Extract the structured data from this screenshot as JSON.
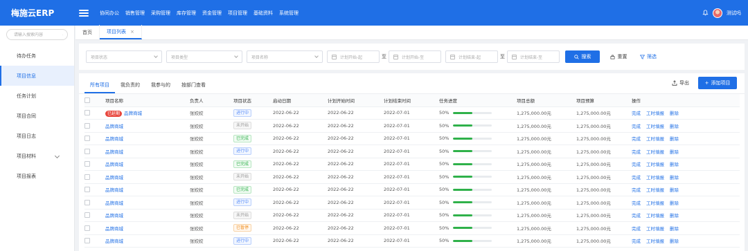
{
  "app": {
    "brand": "梅施云ERP",
    "nav": [
      "协同办公",
      "销售管理",
      "采购管理",
      "库存管理",
      "资金管理",
      "项目管理",
      "基础资料",
      "系统管理"
    ],
    "username": "测试吗"
  },
  "sidebar": {
    "search_placeholder": "请输入搜索内容",
    "items": [
      {
        "label": "待办任务"
      },
      {
        "label": "项目信息",
        "active": true
      },
      {
        "label": "任务计划"
      },
      {
        "label": "项目合同"
      },
      {
        "label": "项目日志"
      },
      {
        "label": "项目材料",
        "has_children": true
      },
      {
        "label": "项目报表"
      }
    ]
  },
  "tabs": {
    "home": "首页",
    "current": "项目列表"
  },
  "filters": {
    "status_placeholder": "项目状态",
    "type_placeholder": "项目类型",
    "name_placeholder": "项目名称",
    "plan_start_from": "计划开始-起",
    "plan_start_to": "计划开始-至",
    "plan_end_from": "计划结束-起",
    "plan_end_to": "计划结束-至",
    "range_sep": "至",
    "search": "搜索",
    "reset": "重置",
    "filter": "筛选"
  },
  "subtabs": {
    "items": [
      "所有项目",
      "我负责的",
      "我参与的",
      "按部门查看"
    ],
    "export": "导出",
    "add": "添加项目"
  },
  "table": {
    "headers": [
      "项目名称",
      "负责人",
      "项目状态",
      "启动日期",
      "计划开始时间",
      "计划结束时间",
      "任务进度",
      "项目总额",
      "项目预算",
      "操作"
    ],
    "overdue_label": "已延期",
    "ops": [
      "完成",
      "工时填报",
      "删除"
    ],
    "rows": [
      {
        "name": "品牌商城",
        "owner": "张姣姣",
        "status": "进行中",
        "status_key": "run",
        "start": "2022-06-22",
        "plan_start": "2022-06-22",
        "plan_end": "2022-07-01",
        "progress": "50%",
        "progress_value": 0.5,
        "total": "1,275,000.00元",
        "budget": "1,275,000.00元",
        "overdue": true
      },
      {
        "name": "品牌商城",
        "owner": "张姣姣",
        "status": "未开始",
        "status_key": "todo",
        "start": "2022-06-22",
        "plan_start": "2022-06-22",
        "plan_end": "2022-07-01",
        "progress": "50%",
        "progress_value": 0.5,
        "total": "1,275,000.00元",
        "budget": "1,275,000.00元"
      },
      {
        "name": "品牌商城",
        "owner": "张姣姣",
        "status": "已完成",
        "status_key": "done",
        "start": "2022-06-22",
        "plan_start": "2022-06-22",
        "plan_end": "2022-07-01",
        "progress": "50%",
        "progress_value": 0.5,
        "total": "1,275,000.00元",
        "budget": "1,275,000.00元"
      },
      {
        "name": "品牌商城",
        "owner": "张姣姣",
        "status": "进行中",
        "status_key": "run",
        "start": "2022-06-22",
        "plan_start": "2022-06-22",
        "plan_end": "2022-07-01",
        "progress": "50%",
        "progress_value": 0.5,
        "total": "1,275,000.00元",
        "budget": "1,275,000.00元"
      },
      {
        "name": "品牌商城",
        "owner": "张姣姣",
        "status": "已完成",
        "status_key": "done",
        "start": "2022-06-22",
        "plan_start": "2022-06-22",
        "plan_end": "2022-07-01",
        "progress": "50%",
        "progress_value": 0.5,
        "total": "1,275,000.00元",
        "budget": "1,275,000.00元"
      },
      {
        "name": "品牌商城",
        "owner": "张姣姣",
        "status": "未开始",
        "status_key": "todo",
        "start": "2022-06-22",
        "plan_start": "2022-06-22",
        "plan_end": "2022-07-01",
        "progress": "50%",
        "progress_value": 0.5,
        "total": "1,275,000.00元",
        "budget": "1,275,000.00元"
      },
      {
        "name": "品牌商城",
        "owner": "张姣姣",
        "status": "已完成",
        "status_key": "done",
        "start": "2022-06-22",
        "plan_start": "2022-06-22",
        "plan_end": "2022-07-01",
        "progress": "50%",
        "progress_value": 0.5,
        "total": "1,275,000.00元",
        "budget": "1,275,000.00元"
      },
      {
        "name": "品牌商城",
        "owner": "张姣姣",
        "status": "进行中",
        "status_key": "run",
        "start": "2022-06-22",
        "plan_start": "2022-06-22",
        "plan_end": "2022-07-01",
        "progress": "50%",
        "progress_value": 0.5,
        "total": "1,275,000.00元",
        "budget": "1,275,000.00元"
      },
      {
        "name": "品牌商城",
        "owner": "张姣姣",
        "status": "未开始",
        "status_key": "todo",
        "start": "2022-06-22",
        "plan_start": "2022-06-22",
        "plan_end": "2022-07-01",
        "progress": "50%",
        "progress_value": 0.5,
        "total": "1,275,000.00元",
        "budget": "1,275,000.00元"
      },
      {
        "name": "品牌商城",
        "owner": "张姣姣",
        "status": "已暂停",
        "status_key": "pause",
        "start": "2022-06-22",
        "plan_start": "2022-06-22",
        "plan_end": "2022-07-01",
        "progress": "50%",
        "progress_value": 0.5,
        "total": "1,275,000.00元",
        "budget": "1,275,000.00元"
      },
      {
        "name": "品牌商城",
        "owner": "张姣姣",
        "status": "进行中",
        "status_key": "run",
        "start": "2022-06-22",
        "plan_start": "2022-06-22",
        "plan_end": "2022-07-01",
        "progress": "50%",
        "progress_value": 0.5,
        "total": "1,275,000.00元",
        "budget": "1,275,000.00元"
      }
    ]
  },
  "colors": {
    "primary": "#1f6fe6",
    "progress": "#2fb14a",
    "overdue": "#e8453c"
  }
}
